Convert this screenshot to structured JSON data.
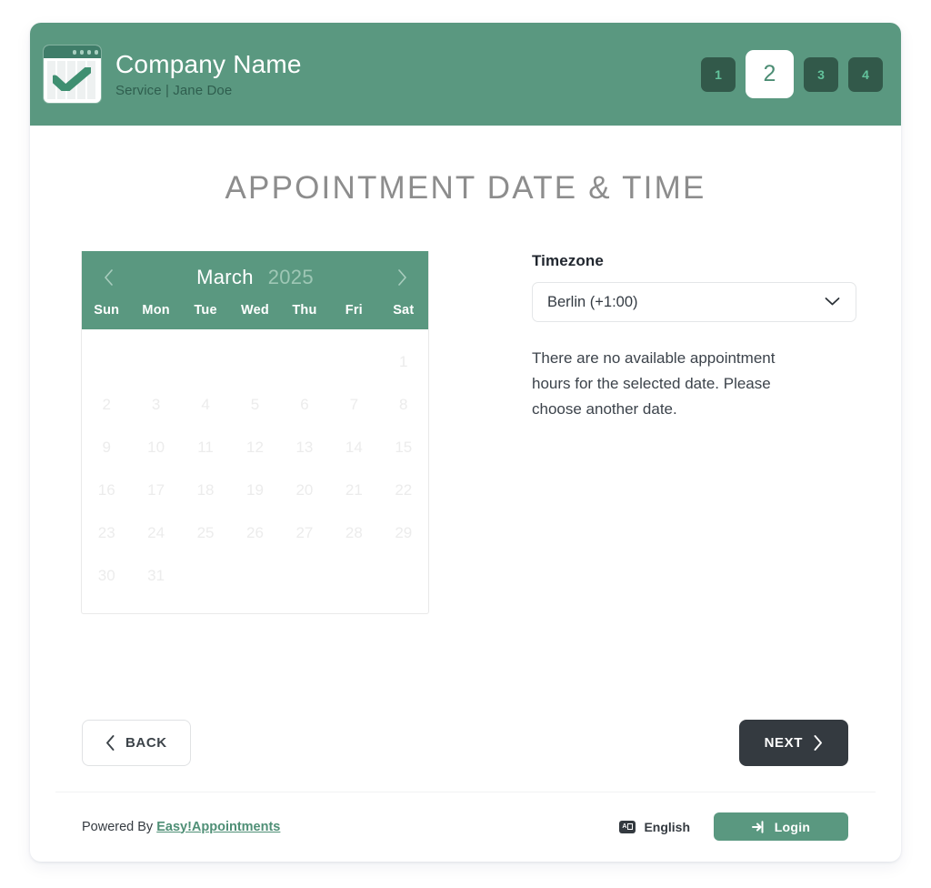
{
  "header": {
    "company_name": "Company Name",
    "subtitle": "Service | Jane Doe",
    "logo_icon": "calendar-check-icon",
    "brand_color": "#5a9880",
    "step_inactive_color": "#32594a",
    "steps": [
      {
        "label": "1",
        "active": false
      },
      {
        "label": "2",
        "active": true
      },
      {
        "label": "3",
        "active": false
      },
      {
        "label": "4",
        "active": false
      }
    ]
  },
  "main": {
    "title": "APPOINTMENT DATE & TIME"
  },
  "calendar": {
    "prev_icon": "chevron-left-icon",
    "next_icon": "chevron-right-icon",
    "month": "March",
    "year": "2025",
    "weekdays": [
      "Sun",
      "Mon",
      "Tue",
      "Wed",
      "Thu",
      "Fri",
      "Sat"
    ],
    "leading_blanks": 6,
    "days": [
      "1",
      "2",
      "3",
      "4",
      "5",
      "6",
      "7",
      "8",
      "9",
      "10",
      "11",
      "12",
      "13",
      "14",
      "15",
      "16",
      "17",
      "18",
      "19",
      "20",
      "21",
      "22",
      "23",
      "24",
      "25",
      "26",
      "27",
      "28",
      "29",
      "30",
      "31"
    ],
    "all_days_disabled": true,
    "selected_day": null
  },
  "timezone": {
    "label": "Timezone",
    "selected": "Berlin (+1:00)",
    "chevron_icon": "chevron-down-icon"
  },
  "message": {
    "no_hours": "There are no available appointment hours for the selected date. Please choose another date."
  },
  "actions": {
    "back_label": "BACK",
    "back_icon": "chevron-left-icon",
    "next_label": "NEXT",
    "next_icon": "chevron-right-icon"
  },
  "footer": {
    "powered_by": "Powered By",
    "powered_link": "Easy!Appointments",
    "language_icon": "translate-icon",
    "language": "English",
    "login_label": "Login",
    "login_icon": "sign-in-icon"
  }
}
